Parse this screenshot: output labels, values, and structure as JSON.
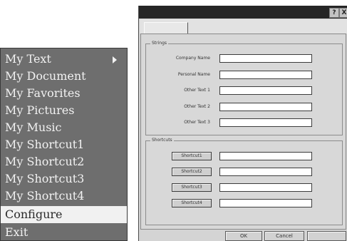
{
  "menu": {
    "items": [
      {
        "label": "My Text",
        "has_submenu": true
      },
      {
        "label": "My Document"
      },
      {
        "label": "My Favorites"
      },
      {
        "label": "My Pictures"
      },
      {
        "label": "My Music"
      },
      {
        "label": "My Shortcut1"
      },
      {
        "label": "My Shortcut2"
      },
      {
        "label": "My Shortcut3"
      },
      {
        "label": "My Shortcut4"
      },
      {
        "label": "Configure",
        "highlighted": true
      },
      {
        "label": "Exit"
      }
    ]
  },
  "dialog": {
    "help_glyph": "?",
    "close_glyph": "X",
    "strings_group": {
      "label": "Strings",
      "fields": [
        {
          "label": "Company Name",
          "value": ""
        },
        {
          "label": "Personal Name",
          "value": ""
        },
        {
          "label": "Other Text 1",
          "value": ""
        },
        {
          "label": "Other Text 2",
          "value": ""
        },
        {
          "label": "Other Text 3",
          "value": ""
        }
      ]
    },
    "shortcuts_group": {
      "label": "Shortcuts",
      "rows": [
        {
          "button": "Shortcut1",
          "value": ""
        },
        {
          "button": "Shortcut2",
          "value": ""
        },
        {
          "button": "Shortcut3",
          "value": ""
        },
        {
          "button": "Shortcut4",
          "value": ""
        }
      ]
    },
    "footer": {
      "ok": "OK",
      "cancel": "Cancel"
    }
  },
  "colors": {
    "menu_bg": "#6e6e6e",
    "menu_text": "#f2f2f2",
    "menu_highlight": "#f1f1f1",
    "titlebar": "#262626",
    "dialog_bg": "#d4d4d4"
  }
}
